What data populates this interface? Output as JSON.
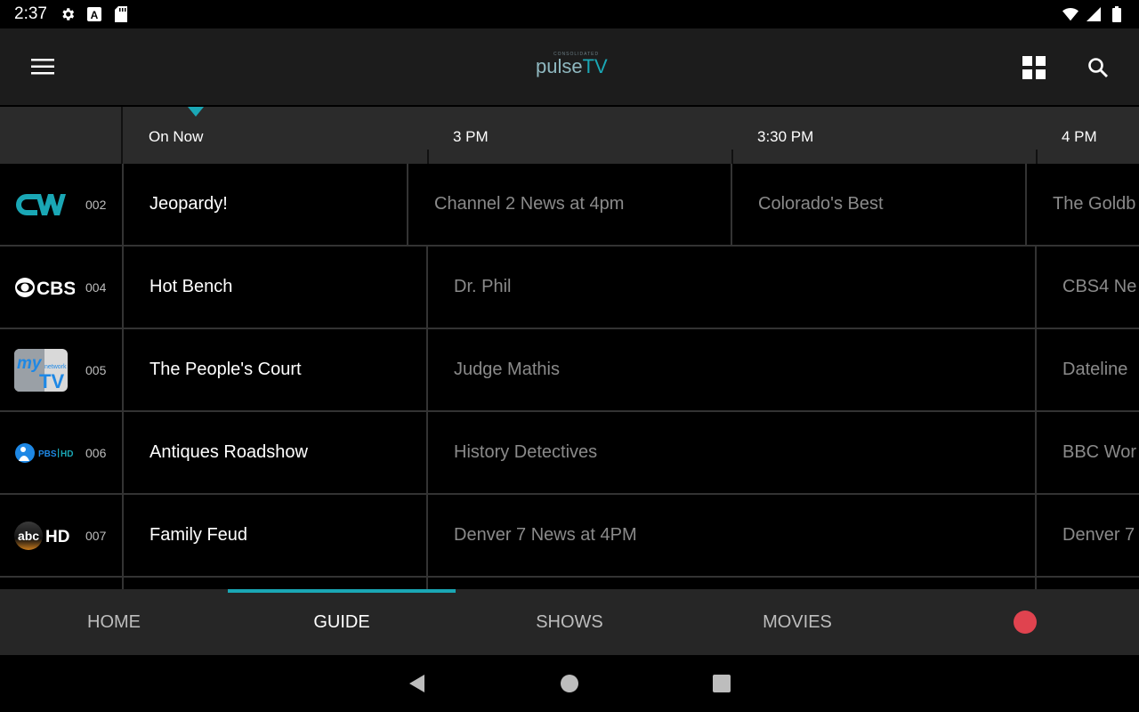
{
  "status_bar": {
    "time": "2:37",
    "left_icons": [
      "settings-icon",
      "font-a-icon",
      "sd-card-icon"
    ],
    "right_icons": [
      "wifi-icon",
      "signal-icon",
      "battery-icon"
    ]
  },
  "app_bar": {
    "logo_small": "CONSOLIDATED",
    "logo_pulse": "pulse",
    "logo_tv": "TV",
    "icons": [
      "menu-icon",
      "grid-icon",
      "search-icon"
    ]
  },
  "timeline": {
    "on_now": "On Now",
    "t1": "3 PM",
    "t2": "3:30 PM",
    "t3": "4 PM"
  },
  "channels": [
    {
      "number": "002",
      "logo_text": "CW",
      "logo_color": "#1aa7b5",
      "programs": [
        {
          "title": "Jeopardy!"
        },
        {
          "title": "Channel 2 News at 4pm"
        },
        {
          "title": "Colorado's Best"
        },
        {
          "title": "The Goldb"
        }
      ]
    },
    {
      "number": "004",
      "logo_text": "CBS",
      "programs": [
        {
          "title": "Hot Bench"
        },
        {
          "title": "Dr. Phil"
        },
        {
          "title": "CBS4 Ne"
        }
      ]
    },
    {
      "number": "005",
      "logo_text": "my TV",
      "programs": [
        {
          "title": "The People's Court"
        },
        {
          "title": "Judge Mathis"
        },
        {
          "title": "Dateline"
        }
      ]
    },
    {
      "number": "006",
      "logo_text": "PBS HD",
      "programs": [
        {
          "title": "Antiques Roadshow"
        },
        {
          "title": "History Detectives"
        },
        {
          "title": "BBC Wor"
        }
      ]
    },
    {
      "number": "007",
      "logo_text": "abc HD",
      "programs": [
        {
          "title": "Family Feud"
        },
        {
          "title": "Denver 7 News at 4PM"
        },
        {
          "title": "Denver 7"
        }
      ]
    }
  ],
  "bottom_nav": {
    "home": "HOME",
    "guide": "GUIDE",
    "shows": "SHOWS",
    "movies": "MOVIES",
    "active": "GUIDE",
    "record_color": "#e0434f"
  },
  "colors": {
    "accent": "#1aa7b5",
    "app_bar": "#1c1c1c",
    "bottom_nav": "#262626"
  }
}
